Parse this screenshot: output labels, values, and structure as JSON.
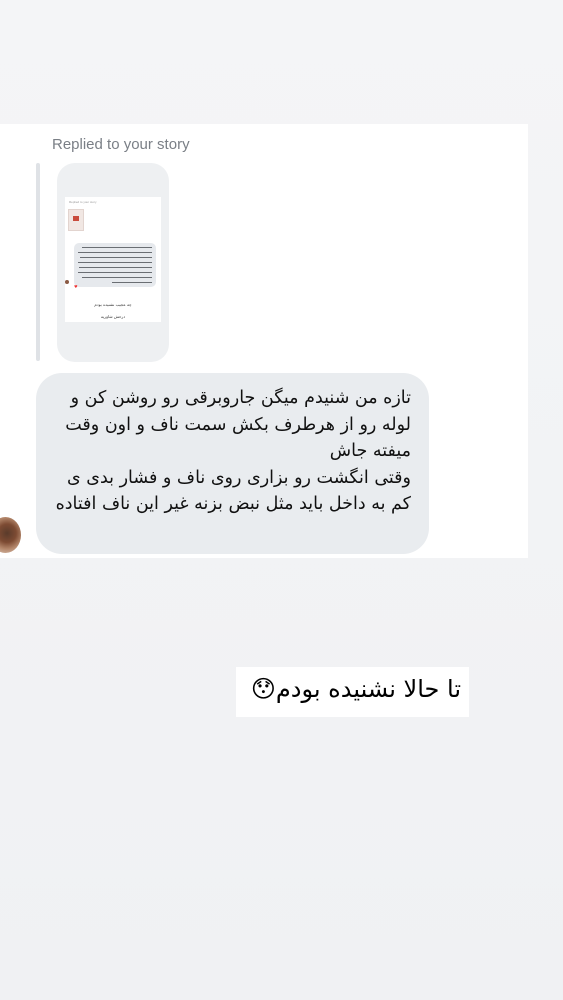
{
  "reply": {
    "label": "Replied to your story"
  },
  "story_thumbnail": {
    "inner_reply_label": "Replied to your story",
    "caption_line1": "چه عجیب نشنیده بودم",
    "caption_line2": "درحش شاوریه"
  },
  "message": {
    "text": "تازه من شنیدم میگن جاروبرقی رو روشن کن و لوله رو از هرطرف بکش سمت ناف و اون وقت میفته جاش\nوقتی انگشت رو بزاری روی ناف و فشار بدی ی کم به داخل باید مثل نبض بزنه غیر این ناف افتاده"
  },
  "overlay": {
    "text": "تا حالا نشنیده بودم😯"
  }
}
